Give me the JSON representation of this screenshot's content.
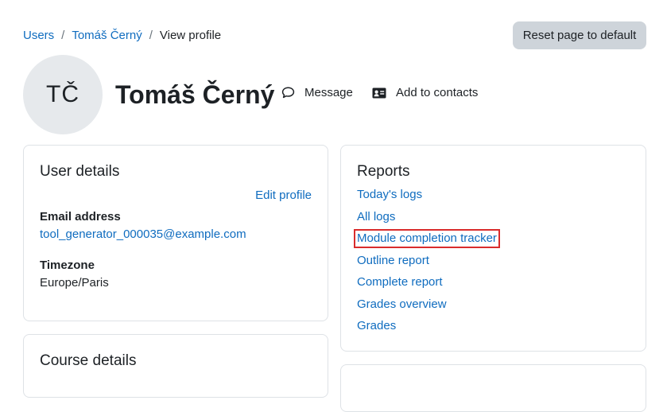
{
  "breadcrumb": {
    "items": [
      "Users",
      "Tomáš Černý"
    ],
    "current": "View profile",
    "separator": "/"
  },
  "reset_button": "Reset page to default",
  "profile": {
    "initials": "TČ",
    "name": "Tomáš Černý",
    "actions": {
      "message": "Message",
      "add_contact": "Add to contacts"
    }
  },
  "user_details": {
    "title": "User details",
    "edit_link": "Edit profile",
    "email_label": "Email address",
    "email_value": "tool_generator_000035@example.com",
    "timezone_label": "Timezone",
    "timezone_value": "Europe/Paris"
  },
  "course_details": {
    "title": "Course details"
  },
  "reports": {
    "title": "Reports",
    "links": [
      "Today's logs",
      "All logs",
      "Module completion tracker",
      "Outline report",
      "Complete report",
      "Grades overview",
      "Grades"
    ]
  },
  "colors": {
    "link": "#0f6cbf",
    "highlight_border": "#d92c2c",
    "button_bg": "#ced4da",
    "avatar_bg": "#e6e9ec"
  },
  "icons": {
    "message": "speech-bubble-icon",
    "contacts": "address-card-icon"
  }
}
